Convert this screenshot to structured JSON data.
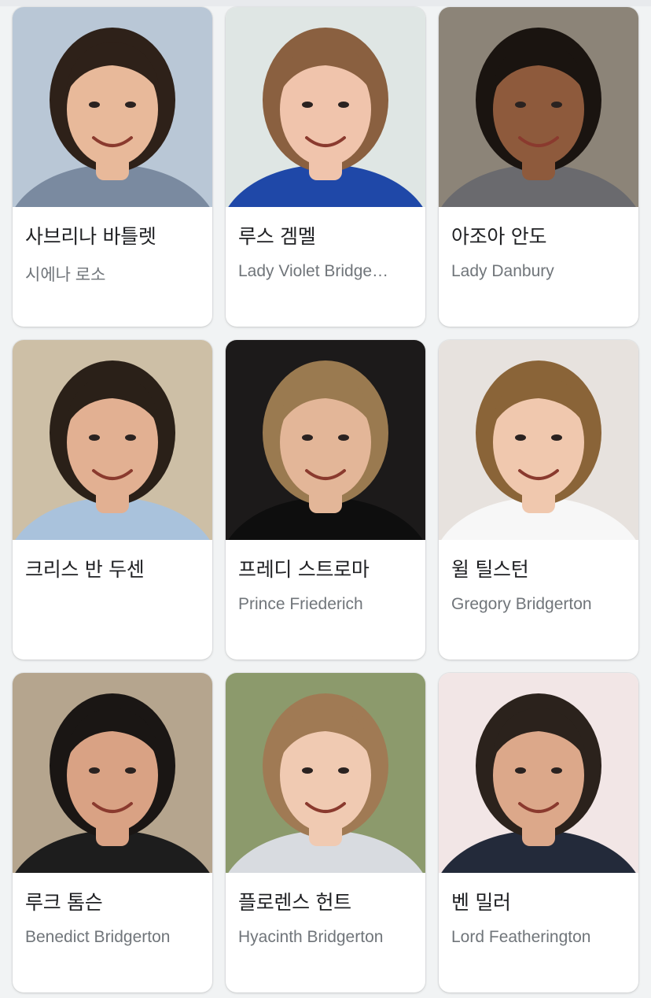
{
  "cast": [
    {
      "name": "사브리나 바틀렛",
      "role": "시에나 로소",
      "photo": {
        "bg": "#b9c7d6",
        "hair": "#2e2119",
        "skin": "#e8b99a",
        "cloth": "#7a8aa0"
      }
    },
    {
      "name": "루스 겜멜",
      "role": "Lady Violet Bridge…",
      "photo": {
        "bg": "#dfe6e4",
        "hair": "#8a6040",
        "skin": "#f0c4ac",
        "cloth": "#1f48a8"
      }
    },
    {
      "name": "아조아 안도",
      "role": "Lady Danbury",
      "photo": {
        "bg": "#8c8478",
        "hair": "#1a1410",
        "skin": "#8e5a3c",
        "cloth": "#6a6a6e"
      }
    },
    {
      "name": "크리스 반 두센",
      "role": "",
      "photo": {
        "bg": "#cdbfa6",
        "hair": "#2a2018",
        "skin": "#e2b092",
        "cloth": "#a9c2dc"
      }
    },
    {
      "name": "프레디 스트로마",
      "role": "Prince Friederich",
      "photo": {
        "bg": "#1c1a1a",
        "hair": "#9a7a50",
        "skin": "#e3b698",
        "cloth": "#0e0e0e"
      }
    },
    {
      "name": "윌 틸스턴",
      "role": "Gregory Bridgerton",
      "photo": {
        "bg": "#e7e2de",
        "hair": "#8a6438",
        "skin": "#f0c8ae",
        "cloth": "#f7f7f7"
      }
    },
    {
      "name": "루크 톰슨",
      "role": "Benedict Bridgerton",
      "photo": {
        "bg": "#b5a58e",
        "hair": "#1a1614",
        "skin": "#d9a284",
        "cloth": "#1d1d1d"
      }
    },
    {
      "name": "플로렌스 헌트",
      "role": "Hyacinth Bridgerton",
      "photo": {
        "bg": "#8c9a6c",
        "hair": "#a07a54",
        "skin": "#f0cab2",
        "cloth": "#d8dbe0"
      }
    },
    {
      "name": "벤 밀러",
      "role": "Lord Featherington",
      "photo": {
        "bg": "#f2e6e6",
        "hair": "#2b221c",
        "skin": "#dca88a",
        "cloth": "#232a3a"
      }
    }
  ]
}
